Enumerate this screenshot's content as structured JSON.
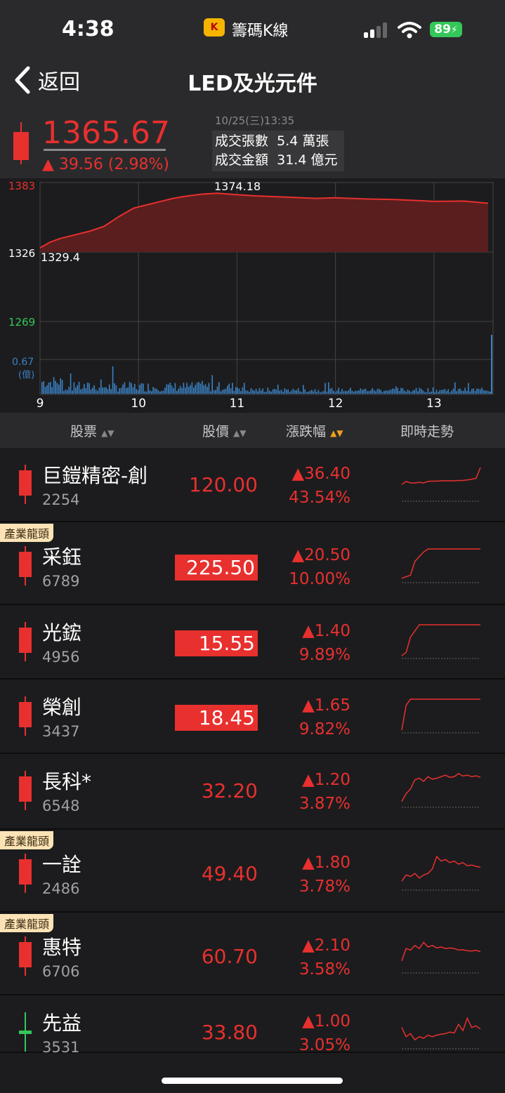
{
  "status_bar": {
    "time": "4:38",
    "app_name": "籌碼K線",
    "app_logo_text": "K",
    "battery": "89"
  },
  "nav": {
    "back_label": "返回",
    "title": "LED及光元件"
  },
  "index": {
    "value": "1365.67",
    "change": "▲ 39.56 (2.98%)",
    "datetime": "10/25(三)13:35",
    "volume_label": "成交張數",
    "volume_value": "5.4 萬張",
    "amount_label": "成交金額",
    "amount_value": "31.4 億元"
  },
  "colors": {
    "up": "#e8302e",
    "down": "#34c759",
    "volume": "#3a82c4",
    "accent": "#f0a020"
  },
  "chart_data": {
    "type": "area",
    "y_labels": {
      "high": "1383",
      "mid": "1326",
      "low": "1269"
    },
    "annotations": {
      "max": "1374.18",
      "min": "1329.4"
    },
    "volume_label": "0.67",
    "volume_unit": "(億)",
    "ylim": [
      1269,
      1383
    ],
    "reference": 1326,
    "x_ticks": [
      "9",
      "10",
      "11",
      "12",
      "13"
    ],
    "x": [
      9.0,
      9.1,
      9.2,
      9.35,
      9.5,
      9.65,
      9.8,
      9.95,
      10.05,
      10.2,
      10.35,
      10.5,
      10.65,
      10.8,
      11.0,
      11.2,
      11.5,
      11.8,
      12.0,
      12.3,
      12.6,
      12.9,
      13.0,
      13.3,
      13.55
    ],
    "values": [
      1329.4,
      1334,
      1337,
      1340,
      1343,
      1347,
      1355,
      1362,
      1364,
      1367,
      1370,
      1372,
      1373.5,
      1374.18,
      1373,
      1372,
      1371,
      1370,
      1370.5,
      1369.5,
      1369,
      1368,
      1367.5,
      1367.8,
      1366
    ],
    "volume_note": "volume bars per minute, 0 to 0.67 億"
  },
  "table": {
    "headers": {
      "stock": "股票",
      "price": "股價",
      "change": "漲跌幅",
      "trend": "即時走勢"
    },
    "rows": [
      {
        "name": "巨鎧精密-創",
        "code": "2254",
        "price": "120.00",
        "boxed": false,
        "tag": "",
        "change": "▲36.40",
        "pct": "43.54%",
        "candle": "up",
        "spark": [
          0.45,
          0.55,
          0.5,
          0.5,
          0.52,
          0.5,
          0.55,
          0.56,
          0.56,
          0.57,
          0.57,
          0.57,
          0.57,
          0.58,
          0.58,
          0.6,
          0.62,
          0.65,
          1.0
        ]
      },
      {
        "name": "采鈺",
        "code": "6789",
        "price": "225.50",
        "boxed": true,
        "tag": "產業龍頭",
        "change": "▲20.50",
        "pct": "10.00%",
        "candle": "up",
        "spark": [
          0.05,
          0.1,
          0.15,
          0.6,
          0.75,
          0.9,
          1,
          1,
          1,
          1,
          1,
          1,
          1,
          1,
          1,
          1,
          1,
          1,
          1
        ]
      },
      {
        "name": "光鋐",
        "code": "4956",
        "price": "15.55",
        "boxed": true,
        "tag": "",
        "change": "▲1.40",
        "pct": "9.89%",
        "candle": "up",
        "spark": [
          0.0,
          0.1,
          0.6,
          0.8,
          1,
          1,
          1,
          1,
          1,
          1,
          1,
          1,
          1,
          1,
          1,
          1,
          1,
          1,
          1
        ]
      },
      {
        "name": "榮創",
        "code": "3437",
        "price": "18.45",
        "boxed": true,
        "tag": "",
        "change": "▲1.65",
        "pct": "9.82%",
        "candle": "up",
        "spark": [
          0.0,
          0.8,
          1,
          1,
          1,
          1,
          1,
          1,
          1,
          1,
          1,
          1,
          1,
          1,
          1,
          1,
          1,
          1,
          1
        ]
      },
      {
        "name": "長科*",
        "code": "6548",
        "price": "32.20",
        "boxed": false,
        "tag": "",
        "change": "▲1.20",
        "pct": "3.87%",
        "candle": "up",
        "spark": [
          0.1,
          0.35,
          0.5,
          0.8,
          0.85,
          0.75,
          0.9,
          0.82,
          0.85,
          0.9,
          0.95,
          0.88,
          0.9,
          1,
          0.92,
          0.95,
          0.9,
          0.93,
          0.88
        ]
      },
      {
        "name": "一詮",
        "code": "2486",
        "price": "49.40",
        "boxed": false,
        "tag": "產業龍頭",
        "change": "▲1.80",
        "pct": "3.78%",
        "candle": "up",
        "spark": [
          0.2,
          0.4,
          0.35,
          0.45,
          0.3,
          0.4,
          0.45,
          0.6,
          1,
          0.85,
          0.9,
          0.8,
          0.85,
          0.75,
          0.8,
          0.7,
          0.72,
          0.68,
          0.65
        ]
      },
      {
        "name": "惠特",
        "code": "6706",
        "price": "60.70",
        "boxed": false,
        "tag": "產業龍頭",
        "change": "▲2.10",
        "pct": "3.58%",
        "candle": "up",
        "spark": [
          0.3,
          0.7,
          0.65,
          0.8,
          0.7,
          0.9,
          0.75,
          0.8,
          0.72,
          0.75,
          0.7,
          0.72,
          0.7,
          0.65,
          0.66,
          0.63,
          0.62,
          0.64,
          0.6
        ]
      },
      {
        "name": "先益",
        "code": "3531",
        "price": "33.80",
        "boxed": false,
        "tag": "",
        "change": "▲1.00",
        "pct": "3.05%",
        "candle": "flat",
        "spark": [
          0.6,
          0.3,
          0.4,
          0.2,
          0.3,
          0.25,
          0.35,
          0.3,
          0.35,
          0.38,
          0.4,
          0.45,
          0.42,
          0.7,
          0.5,
          0.9,
          0.6,
          0.65,
          0.55
        ]
      }
    ]
  }
}
